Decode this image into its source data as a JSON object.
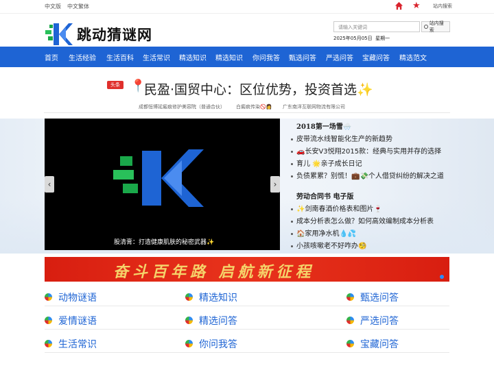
{
  "topbar": {
    "lang_simplified": "中文版",
    "lang_traditional": "中文繁体",
    "home_icon": "home-icon",
    "star_icon": "star-icon",
    "site_search_link": "站内搜索"
  },
  "header": {
    "site_name": "跳动猜谜网",
    "search_placeholder": "请输入关键词",
    "search_button": "站内搜索",
    "date": "2025年05月05日",
    "weekday": "星期一"
  },
  "nav": [
    "首页",
    "生活经验",
    "生活百科",
    "生活常识",
    "精选知识",
    "精选知识",
    "你问我答",
    "甄选问答",
    "严选问答",
    "宝藏问答",
    "精选范文"
  ],
  "headline": {
    "badge": "头条",
    "text": "民盈·国贸中心：区位优势，投资首选✨",
    "sub_links": [
      "成都恒博延瘢痕修护美容院（普通合伙）",
      "白癜疯传染🚫👩",
      "广东南洋互联网物流有限公司"
    ]
  },
  "slide": {
    "caption": "股清膏：打造健康肌肤的秘密武器✨"
  },
  "news_groups": [
    {
      "title": "2018第一场雪🌨️",
      "items": [
        "皮带流水线智能化生产的新趋势",
        "🚗长安V3悦翔2015款：经典与实用并存的选择",
        "育儿 🌟亲子成长日记",
        "负债累累？别慌！💼💸个人借贷纠纷的解决之道"
      ]
    },
    {
      "title": "劳动合同书 电子版",
      "items": [
        "✨剑南春酒价格表和图片🍷",
        "成本分析表怎么做？如何高效编制成本分析表",
        "🏠家用净水机💧💦",
        "小孩咳嗽老不好咋办🧐"
      ]
    }
  ],
  "banner": {
    "text": "奋斗百年路 启航新征程"
  },
  "categories": [
    [
      "动物谜语",
      "精选知识",
      "甄选问答"
    ],
    [
      "爱情谜语",
      "精选问答",
      "严选问答"
    ],
    [
      "生活常识",
      "你问我答",
      "宝藏问答"
    ]
  ],
  "colors": {
    "nav_bg": "#1e64d4",
    "accent_red": "#e0302c",
    "link_blue": "#1e64d4"
  }
}
